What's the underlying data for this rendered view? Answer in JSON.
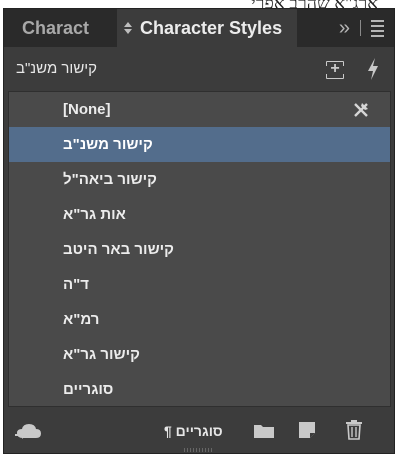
{
  "background": {
    "doc_text": "ארג\"א שהרב אפרי"
  },
  "tabs": {
    "inactive_label": "Charact",
    "active_label": "Character Styles",
    "more_label": "»"
  },
  "header": {
    "current_style": "קישור משנ\"ב"
  },
  "list": {
    "items": [
      {
        "label": "[None]",
        "selected": false
      },
      {
        "label": "קישור משנ\"ב",
        "selected": true
      },
      {
        "label": "קישור ביאה\"ל",
        "selected": false
      },
      {
        "label": "אות גר\"א",
        "selected": false
      },
      {
        "label": "קישור באר היטב",
        "selected": false
      },
      {
        "label": "ד\"ה",
        "selected": false
      },
      {
        "label": "רמ\"א",
        "selected": false
      },
      {
        "label": "קישור גר\"א",
        "selected": false
      },
      {
        "label": "סוגריים",
        "selected": false
      }
    ]
  },
  "footer": {
    "style_name": "סוגריים ¶"
  },
  "colors": {
    "panel_bg": "#3c3c3c",
    "list_bg": "#4a4a4a",
    "selected_bg": "#536d8c",
    "tabbar_bg": "#2a2a2a",
    "text": "#ececec"
  },
  "icons": [
    "sort-arrows-icon",
    "double-chevron-icon",
    "menu-icon",
    "new-group-icon",
    "lightning-icon",
    "pen-x-icon",
    "cloud-icon",
    "folder-icon",
    "new-style-icon",
    "trash-icon"
  ]
}
